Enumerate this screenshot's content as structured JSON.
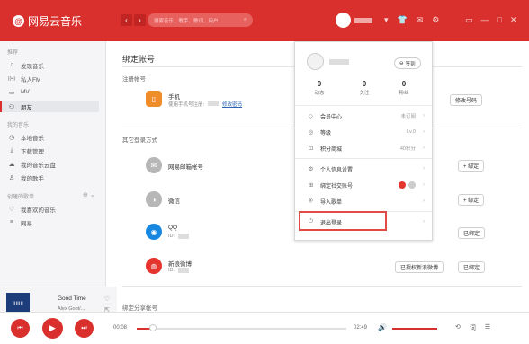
{
  "app": {
    "name": "网易云音乐"
  },
  "topbar": {
    "search_placeholder": "搜索音乐、歌手、歌词、用户",
    "nav_back": "‹",
    "nav_forward": "›"
  },
  "sidebar": {
    "section_recommend": "推荐",
    "recommend_items": [
      {
        "label": "发现音乐",
        "icon": "♫"
      },
      {
        "label": "私人FM",
        "icon": "((•))"
      },
      {
        "label": "MV",
        "icon": "▭"
      },
      {
        "label": "朋友",
        "icon": "👥"
      }
    ],
    "section_my_music": "我的音乐",
    "music_items": [
      {
        "label": "本地音乐",
        "icon": "◷"
      },
      {
        "label": "下载管理",
        "icon": "⤓"
      },
      {
        "label": "我的音乐云盘",
        "icon": "☁"
      },
      {
        "label": "我的歌手",
        "icon": "♙"
      }
    ],
    "section_created": "创建的歌单",
    "created_items": [
      {
        "label": "我喜欢的音乐",
        "icon": "♡"
      },
      {
        "label": "网易",
        "icon": "≡"
      }
    ]
  },
  "now_playing": {
    "title": "Good Time",
    "artist": "Alex Goot/...",
    "album_label": "IIIIIII"
  },
  "main": {
    "title": "绑定帐号",
    "registered_section": "注册帐号",
    "phone_row": {
      "name": "手机",
      "sub_prefix": "使用手机号注册:",
      "link": "修改密码",
      "button": "修改号码"
    },
    "other_section": "其它登录方式",
    "rows": [
      {
        "name": "网易邮箱帐号",
        "sub": "",
        "button": "+ 绑定",
        "icon": "✉",
        "color": "#b7b7b7"
      },
      {
        "name": "微信",
        "sub": "",
        "button": "+ 绑定",
        "icon": "◑",
        "color": "#b7b7b7"
      },
      {
        "name": "QQ",
        "sub": "ID:",
        "button": "已绑定",
        "icon": "◉",
        "color": "#1787e0"
      },
      {
        "name": "新浪微博",
        "sub": "ID:",
        "button": "已绑定",
        "extra": "已授权新浪微博",
        "icon": "◍",
        "color": "#e4352f"
      }
    ],
    "share_section": "绑定分享帐号"
  },
  "player": {
    "current_time": "00:08",
    "total_time": "02:49",
    "progress_fraction": 0.07,
    "prev": "⏮",
    "play": "▶",
    "next": "⏭"
  },
  "dropdown": {
    "signin": "签到",
    "stats": [
      {
        "value": "0",
        "label": "动态"
      },
      {
        "value": "0",
        "label": "关注"
      },
      {
        "value": "0",
        "label": "粉丝"
      }
    ],
    "items": [
      {
        "label": "会员中心",
        "icon": "◇",
        "right": "未订阅"
      },
      {
        "label": "等级",
        "icon": "◎",
        "right": "Lv.0"
      },
      {
        "label": "积分商城",
        "icon": "⊡",
        "right": "40积分"
      },
      {
        "label": "个人信息设置",
        "icon": "⚙",
        "right": ""
      },
      {
        "label": "绑定社交账号",
        "icon": "⊞",
        "right": ""
      },
      {
        "label": "导入歌单",
        "icon": "⎆",
        "right": ""
      },
      {
        "label": "退出登录",
        "icon": "⏻",
        "right": ""
      }
    ]
  }
}
